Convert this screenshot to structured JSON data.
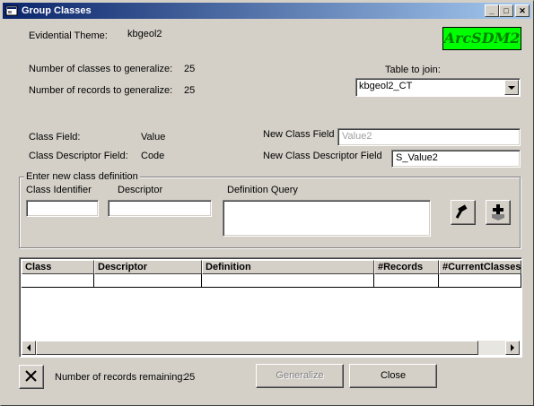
{
  "window": {
    "title": "Group Classes",
    "minimize_glyph": "_",
    "maximize_glyph": "□",
    "close_glyph": "✕"
  },
  "logo_text": "ArcSDM2",
  "theme": {
    "label": "Evidential Theme:",
    "value": "kbgeol2"
  },
  "classes": {
    "label": "Number of classes to generalize:",
    "value": "25"
  },
  "records": {
    "label": "Number of records to generalize:",
    "value": "25"
  },
  "table_join": {
    "label": "Table to join:",
    "selected": "kbgeol2_CT"
  },
  "class_field": {
    "label": "Class Field:",
    "value": "Value"
  },
  "class_descriptor_field": {
    "label": "Class Descriptor Field:",
    "value": "Code"
  },
  "new_class_field": {
    "label": "New Class Field",
    "value": "Value2"
  },
  "new_class_descriptor_field": {
    "label": "New Class Descriptor Field",
    "value": "S_Value2"
  },
  "definition_group": {
    "title": "Enter new class definition",
    "class_identifier_label": "Class Identifier",
    "descriptor_label": "Descriptor",
    "definition_query_label": "Definition Query",
    "class_identifier_value": "",
    "descriptor_value": "",
    "definition_query_value": ""
  },
  "grid": {
    "columns": [
      "Class",
      "Descriptor",
      "Definition",
      "#Records",
      "#CurrentClasses"
    ]
  },
  "footer": {
    "remaining_label": "Number of records remaining:",
    "remaining_value": "25",
    "generalize_label": "Generalize",
    "close_label": "Close"
  },
  "icons": {
    "title_icon": "window-icon",
    "build_query": "hammer-icon",
    "add_class": "add-plus-icon",
    "delete": "delete-x-icon"
  }
}
